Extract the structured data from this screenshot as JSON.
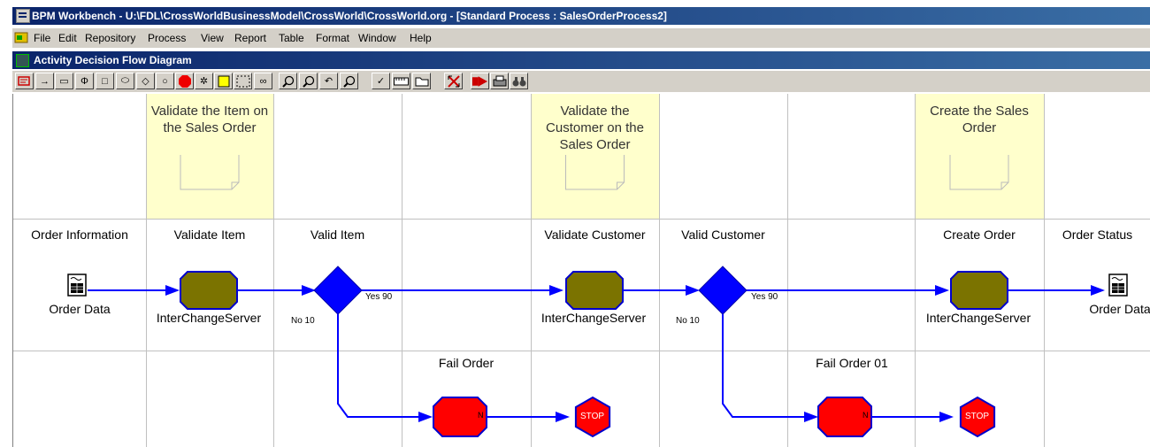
{
  "window": {
    "title": "BPM Workbench - U:\\FDL\\CrossWorldBusinessModel\\CrossWorld\\CrossWorld.org - [Standard Process : SalesOrderProcess2]"
  },
  "menu": [
    "File",
    "Edit",
    "Repository",
    "Process",
    "View",
    "Report",
    "Table",
    "Format",
    "Window",
    "Help"
  ],
  "subwindow": {
    "title": "Activity Decision Flow Diagram"
  },
  "toolbar": [
    {
      "name": "select-tool-icon",
      "glyph": ""
    },
    {
      "name": "connector-tool-icon",
      "glyph": "→"
    },
    {
      "name": "rounded-rect-tool-icon",
      "glyph": "▭"
    },
    {
      "name": "phi-tool-icon",
      "glyph": "Φ"
    },
    {
      "name": "rect-tool-icon",
      "glyph": "□"
    },
    {
      "name": "ellipse-tool-icon",
      "glyph": "⬭"
    },
    {
      "name": "diamond-tool-icon",
      "glyph": "◇"
    },
    {
      "name": "circle-tool-icon",
      "glyph": "○"
    },
    {
      "name": "stop-tool-icon",
      "glyph": ""
    },
    {
      "name": "gear-tool-icon",
      "glyph": "✲"
    },
    {
      "name": "note-tool-icon",
      "glyph": ""
    },
    {
      "name": "dashed-box-tool-icon",
      "glyph": ""
    },
    {
      "name": "link-tool-icon",
      "glyph": "∞"
    },
    {
      "name": "zoom-out-icon",
      "glyph": "🔍"
    },
    {
      "name": "zoom-in-icon",
      "glyph": "🔍"
    },
    {
      "name": "undo-icon",
      "glyph": "↶"
    },
    {
      "name": "find-icon",
      "glyph": "🔍"
    },
    {
      "name": "check-icon",
      "glyph": "✓"
    },
    {
      "name": "ruler-icon",
      "glyph": ""
    },
    {
      "name": "folder-icon",
      "glyph": ""
    },
    {
      "name": "fit-icon",
      "glyph": "✕"
    },
    {
      "name": "run-icon",
      "glyph": ""
    },
    {
      "name": "print-icon",
      "glyph": ""
    },
    {
      "name": "binoculars-icon",
      "glyph": ""
    }
  ],
  "lanes": [
    "Order Information",
    "Validate Item",
    "Valid Item",
    "",
    "Validate Customer",
    "Valid Customer",
    "",
    "Create Order",
    "Order Status"
  ],
  "notes": [
    {
      "text": "Validate the Item on the Sales Order"
    },
    {
      "text": "Validate the Customer on the Sales Order"
    },
    {
      "text": "Create the Sales Order"
    }
  ],
  "nodes": {
    "order_data_in": "Order Data",
    "ics1": "InterChangeServer",
    "ics2": "InterChangeServer",
    "ics3": "InterChangeServer",
    "order_data_out": "Order Data"
  },
  "decisions": [
    {
      "yes": "Yes 90",
      "no": "No 10"
    },
    {
      "yes": "Yes 90",
      "no": "No 10"
    }
  ],
  "fail_labels": [
    "Fail Order",
    "Fail Order 01"
  ],
  "fail_node_letter": "N",
  "stop_label": "STOP",
  "colors": {
    "task": "#7b7300",
    "decision": "#0000ff",
    "fail": "#ff0000",
    "line": "#0000ff",
    "note": "#ffffcc",
    "grid": "#c0c0c0"
  }
}
